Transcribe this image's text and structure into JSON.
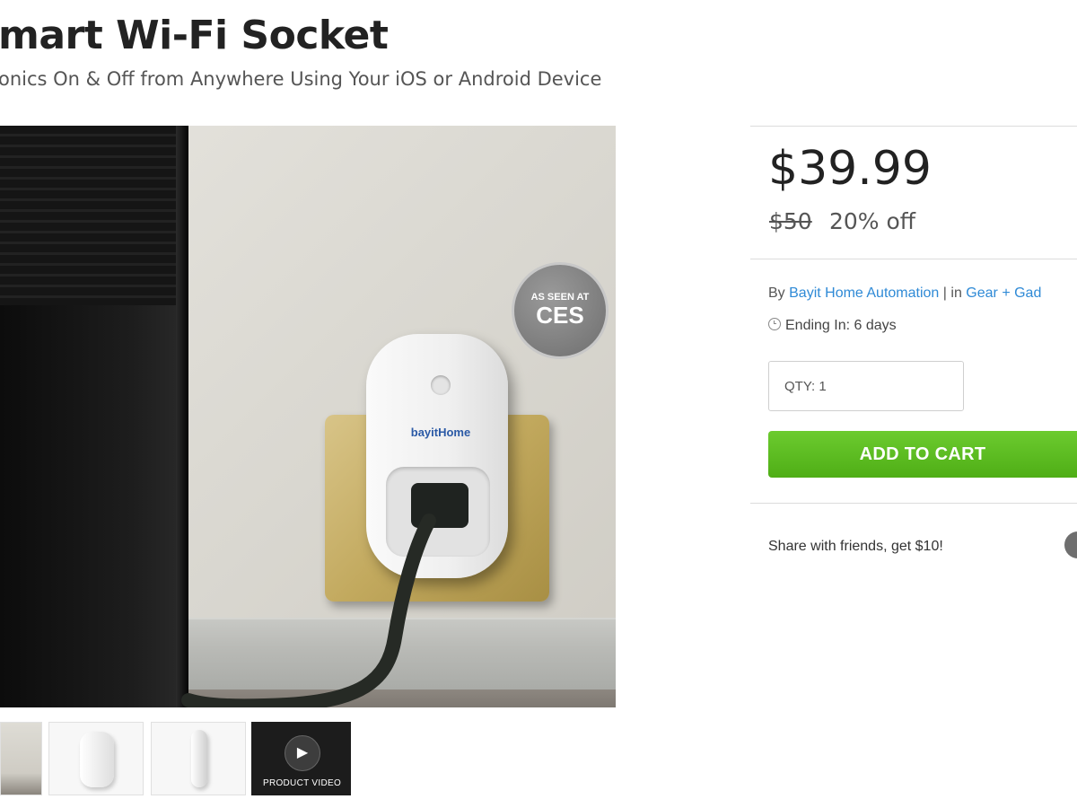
{
  "product": {
    "title": "mart Wi-Fi Socket",
    "subtitle": "onics On & Off from Anywhere Using Your iOS or Android Device"
  },
  "hero_image": {
    "badge_line1": "AS SEEN AT",
    "badge_line2": "CES",
    "brand_label": "bayitHome"
  },
  "thumbnails": {
    "video_label": "PRODUCT VIDEO",
    "play_glyph": "▶"
  },
  "pricing": {
    "price": "$39.99",
    "original_price": "$50",
    "discount": "20% off"
  },
  "meta": {
    "by_prefix": "By",
    "vendor": "Bayit Home Automation",
    "separator": "| in",
    "category": "Gear + Gad",
    "ending": "Ending In: 6 days"
  },
  "cart": {
    "qty_label": "QTY: 1",
    "add_to_cart": "ADD TO CART"
  },
  "share": {
    "text": "Share with friends, get $10!"
  },
  "colors": {
    "accent_green": "#5cbd22",
    "link_blue": "#2f8ad6"
  },
  "icons": [
    "clock-icon",
    "play-icon",
    "share-icon"
  ]
}
